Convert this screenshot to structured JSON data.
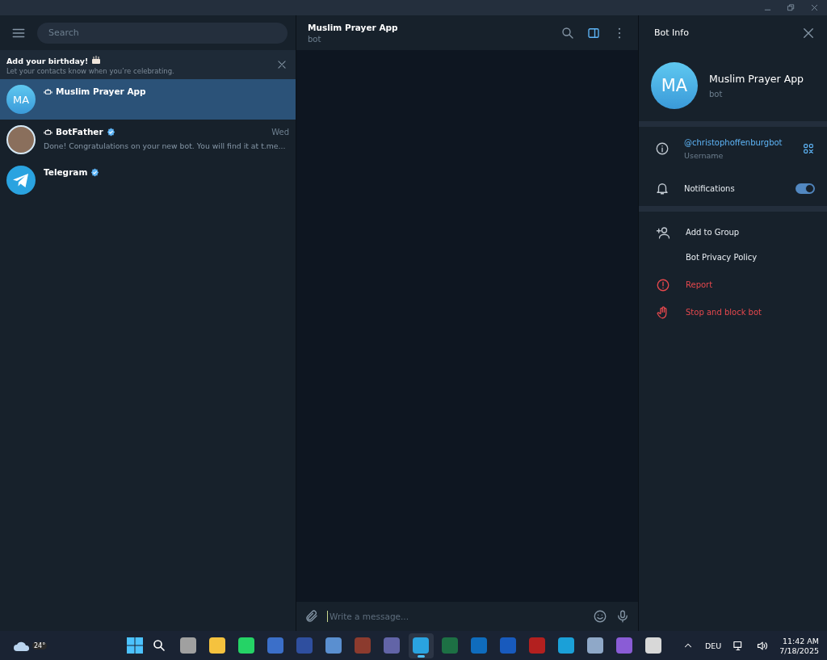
{
  "sidebar": {
    "search": {
      "placeholder": "Search"
    },
    "banner": {
      "title": "Add your birthday!",
      "subtitle": "Let your contacts know when you’re celebrating."
    },
    "chats": [
      {
        "name": "Muslim Prayer App",
        "kind": "initials",
        "initials": "MA",
        "bot": true,
        "verified": false,
        "selected": true
      },
      {
        "name": "BotFather",
        "kind": "photo",
        "bot": true,
        "verified": true,
        "time": "Wed",
        "preview": "Done! Congratulations on your new bot. You will find it at t.me...",
        "selected": false
      },
      {
        "name": "Telegram",
        "kind": "logo",
        "bot": false,
        "verified": true,
        "selected": false
      }
    ]
  },
  "chat": {
    "title": "Muslim Prayer App",
    "status": "bot",
    "info_panel_open": true,
    "composer": {
      "placeholder": "Write a message..."
    }
  },
  "info": {
    "title": "Bot Info",
    "initials": "MA",
    "name": "Muslim Prayer App",
    "status": "bot",
    "username": "@christophoffenburgbot",
    "username_label": "Username",
    "notifications_label": "Notifications",
    "notifications_on": true,
    "actions": [
      {
        "label": "Add to Group",
        "kind": "add",
        "danger": false
      },
      {
        "label": "Bot Privacy Policy",
        "kind": "plain",
        "danger": false
      },
      {
        "label": "Report",
        "kind": "report",
        "danger": true
      },
      {
        "label": "Stop and block bot",
        "kind": "block",
        "danger": true
      }
    ]
  },
  "taskbar": {
    "weather": "24°",
    "apps": [
      {
        "color": "#a0a0a0",
        "active": false
      },
      {
        "color": "#f5c23e",
        "active": false
      },
      {
        "color": "#25d366",
        "active": false
      },
      {
        "color": "#3b6fc9",
        "active": false
      },
      {
        "color": "#2f4f9f",
        "active": false
      },
      {
        "color": "#5a8fd0",
        "active": false
      },
      {
        "color": "#8c3b2e",
        "active": false
      },
      {
        "color": "#6264a7",
        "active": false
      },
      {
        "color": "#2aa3e0",
        "active": true
      },
      {
        "color": "#1d7044",
        "active": false
      },
      {
        "color": "#0f6cbd",
        "active": false
      },
      {
        "color": "#185abd",
        "active": false
      },
      {
        "color": "#b3201f",
        "active": false
      },
      {
        "color": "#1ba0d8",
        "active": false
      },
      {
        "color": "#8fa8c8",
        "active": false
      },
      {
        "color": "#8a5cd6",
        "active": false
      },
      {
        "color": "#d8d8d8",
        "active": false
      }
    ],
    "language": "DEU",
    "time": "11:42 AM",
    "date": "7/18/2025"
  }
}
